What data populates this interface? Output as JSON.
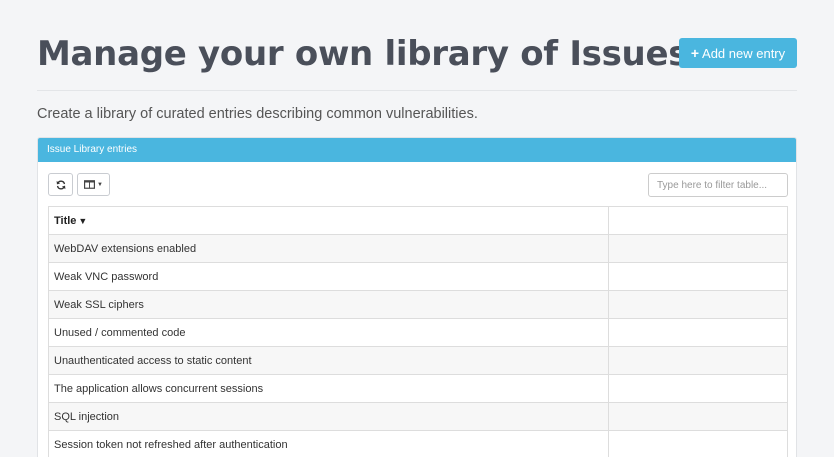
{
  "header": {
    "title": "Manage your own library of Issues",
    "add_button_label": "Add new entry",
    "subtitle": "Create a library of curated entries describing common vulnerabilities."
  },
  "panel": {
    "title": "Issue Library entries",
    "filter_placeholder": "Type here to filter table..."
  },
  "table": {
    "columns": [
      "Title",
      ""
    ],
    "rows": [
      {
        "title": "WebDAV extensions enabled",
        "extra": ""
      },
      {
        "title": "Weak VNC password",
        "extra": ""
      },
      {
        "title": "Weak SSL ciphers",
        "extra": ""
      },
      {
        "title": "Unused / commented code",
        "extra": ""
      },
      {
        "title": "Unauthenticated access to static content",
        "extra": ""
      },
      {
        "title": "The application allows concurrent sessions",
        "extra": ""
      },
      {
        "title": "SQL injection",
        "extra": ""
      },
      {
        "title": "Session token not refreshed after authentication",
        "extra": ""
      }
    ],
    "sort_column": "Title",
    "sort_direction": "descending"
  },
  "icons": {
    "add": "plus-icon",
    "refresh": "refresh-icon",
    "columns": "columns-icon",
    "sort": "caret-down-icon"
  },
  "colors": {
    "accent": "#4ab6df",
    "title": "#4a4f5a",
    "background": "#f4f5f7"
  }
}
